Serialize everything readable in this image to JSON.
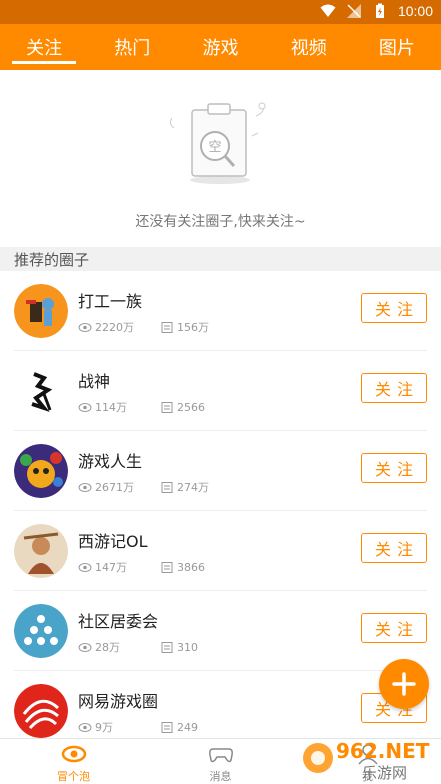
{
  "status": {
    "time": "10:00"
  },
  "tabs": [
    {
      "label": "关注",
      "active": true
    },
    {
      "label": "热门",
      "active": false
    },
    {
      "label": "游戏",
      "active": false
    },
    {
      "label": "视频",
      "active": false
    },
    {
      "label": "图片",
      "active": false
    }
  ],
  "empty": {
    "illustration_text": "空",
    "message": "还没有关注圈子,快来关注~"
  },
  "section": {
    "title": "推荐的圈子"
  },
  "circles": [
    {
      "name": "打工一族",
      "views": "2220万",
      "posts": "156万",
      "follow_label": "关注"
    },
    {
      "name": "战神",
      "views": "114万",
      "posts": "2566",
      "follow_label": "关注"
    },
    {
      "name": "游戏人生",
      "views": "2671万",
      "posts": "274万",
      "follow_label": "关注"
    },
    {
      "name": "西游记OL",
      "views": "147万",
      "posts": "3866",
      "follow_label": "关注"
    },
    {
      "name": "社区居委会",
      "views": "28万",
      "posts": "310",
      "follow_label": "关注"
    },
    {
      "name": "网易游戏圈",
      "views": "9万",
      "posts": "249",
      "follow_label": "关注"
    }
  ],
  "nav": [
    {
      "label": "冒个泡",
      "active": true
    },
    {
      "label": "消息",
      "active": false
    },
    {
      "label": "我",
      "active": false
    }
  ],
  "watermark": {
    "text": "962.NET",
    "subtext": "乐游网"
  },
  "colors": {
    "accent": "#ff8a00",
    "statusbar": "#d46a00"
  }
}
